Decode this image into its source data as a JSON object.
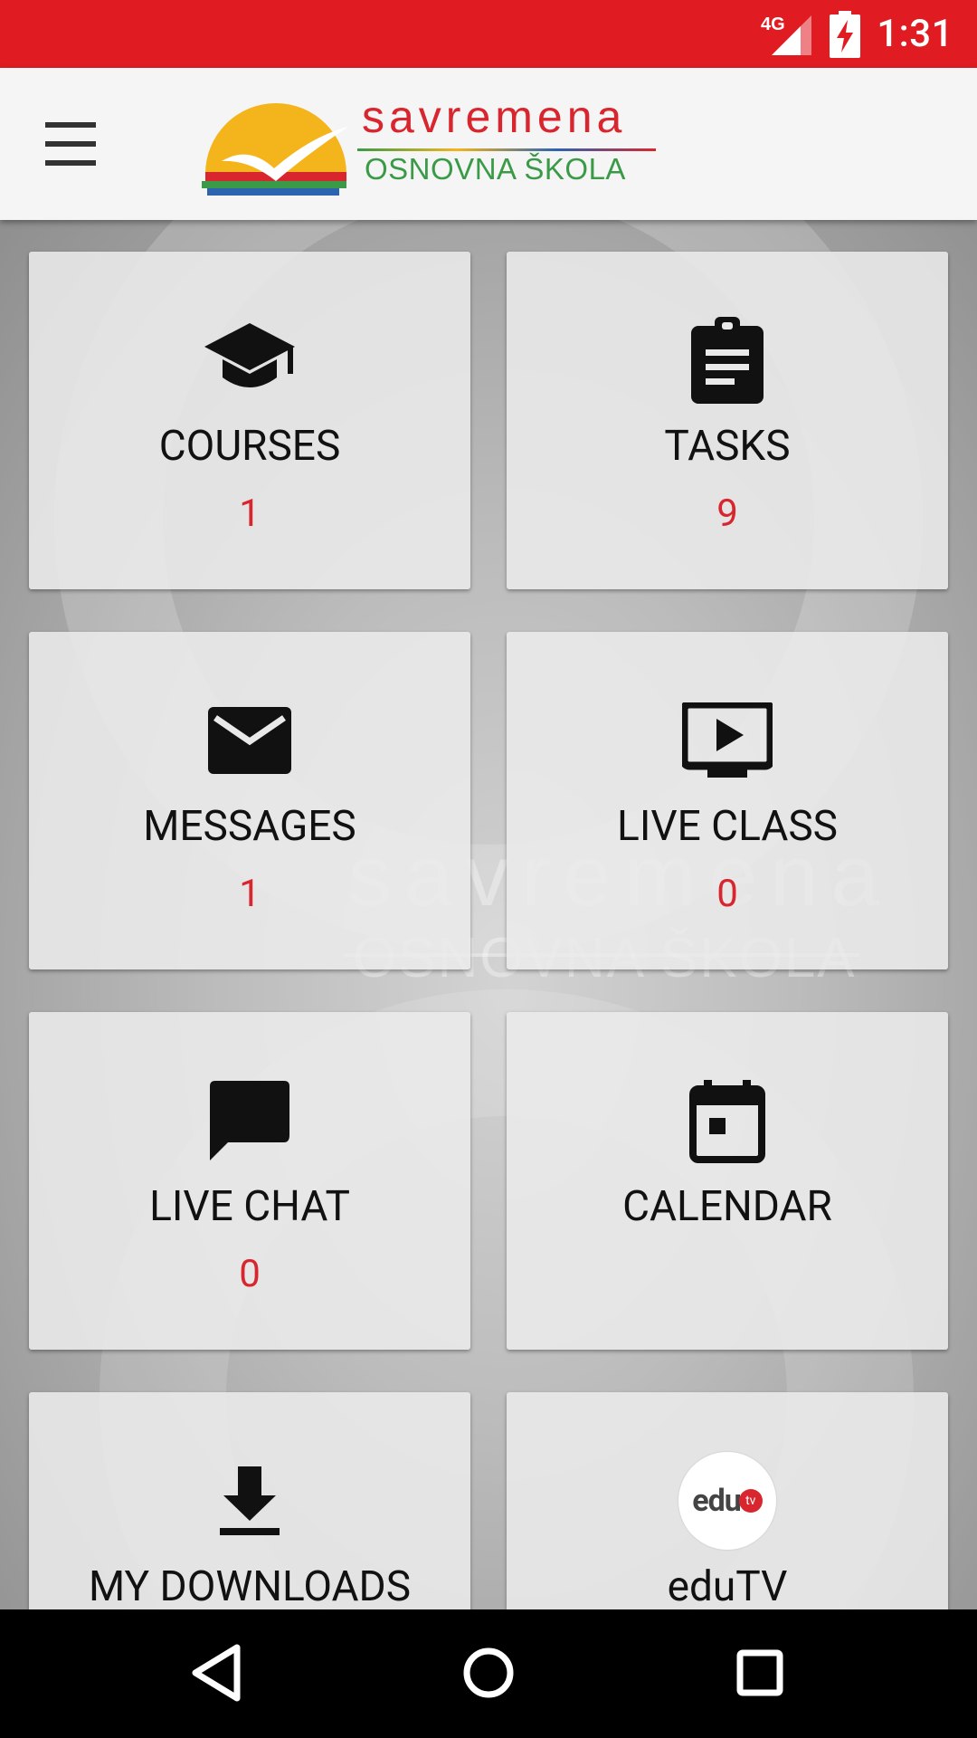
{
  "status_bar": {
    "network": "4G",
    "time": "1:31",
    "color": "#E01B22"
  },
  "toolbar": {
    "menu_icon": "hamburger-menu-icon",
    "logo": {
      "line1": "savremena",
      "line2": "OSNOVNA ŠKOLA"
    }
  },
  "background": {
    "watermark_line1": "savremena",
    "watermark_line2": "OSNOVNA ŠKOLA"
  },
  "tiles": [
    {
      "label": "COURSES",
      "count": "1",
      "icon": "graduation-cap-icon"
    },
    {
      "label": "TASKS",
      "count": "9",
      "icon": "clipboard-icon"
    },
    {
      "label": "MESSAGES",
      "count": "1",
      "icon": "envelope-icon"
    },
    {
      "label": "LIVE CLASS",
      "count": "0",
      "icon": "tv-play-icon"
    },
    {
      "label": "LIVE CHAT",
      "count": "0",
      "icon": "chat-bubble-icon"
    },
    {
      "label": "CALENDAR",
      "count": "",
      "icon": "calendar-icon"
    },
    {
      "label": "MY DOWNLOADS",
      "count": "",
      "icon": "download-icon"
    },
    {
      "label": "eduTV",
      "count": "",
      "icon": "edutv-logo-icon",
      "logo_text": "edu",
      "logo_badge": "tv"
    }
  ],
  "colors": {
    "accent": "#E01B22",
    "count_text": "#D9262E",
    "logo_green": "#3A9A48"
  },
  "nav_bar": {
    "back_icon": "back-triangle-icon",
    "home_icon": "home-circle-icon",
    "recents_icon": "recents-square-icon"
  }
}
